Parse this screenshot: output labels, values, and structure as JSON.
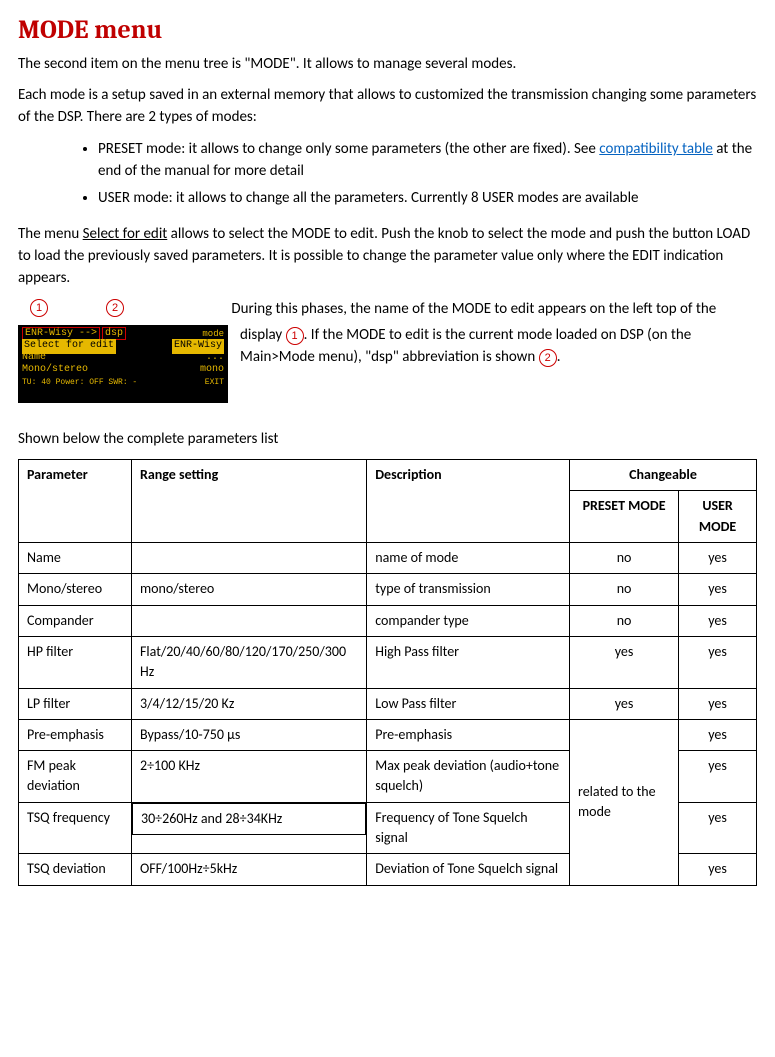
{
  "title": "MODE menu",
  "intro": "The second item on the menu tree is \"MODE\". It allows to manage several modes.",
  "para2a": "Each mode is a setup saved in an external memory that allows to customized the transmission changing some parameters of the DSP. There are 2 types of modes:",
  "bullets": {
    "b1a": "PRESET mode: it allows to change only some parameters (the other are fixed). See ",
    "b1link": "compatibility table",
    "b1b": " at the end of the manual for more detail",
    "b2": "USER mode: it allows to change all the parameters. Currently 8 USER modes are available"
  },
  "para3a": "The menu ",
  "para3u": "Select for edit",
  "para3b": " allows to select the MODE to edit. Push the knob to select the mode and push the button LOAD to load the previously saved parameters. It is possible to change the parameter value only where the EDIT indication appears.",
  "figtop": "During this phases, the name of the MODE to edit appears on the left top of the ",
  "figright_a": "display ",
  "figright_b": ". If the MODE to edit is the current mode loaded on DSP (on the Main>Mode menu), \"dsp\" abbreviation is shown ",
  "figright_c": ".",
  "mark1": "1",
  "mark2": "2",
  "lcd": {
    "r1a": "ENR-Wisy -->",
    "r1b": "dsp",
    "r1r": "mode",
    "r2a": "Select for edit",
    "r2b": "ENR-Wisy",
    "r3a": "Name",
    "r3b": "...",
    "r4a": "Mono/stereo",
    "r4b": "mono",
    "r5a": "TU: 40    Power: OFF    SWR: -",
    "r5b": "EXIT"
  },
  "caption": "Shown below the complete parameters list",
  "th": {
    "param": "Parameter",
    "range": "Range setting",
    "desc": "Description",
    "chg": "Changeable",
    "preset": "PRESET MODE",
    "user": "USER MODE"
  },
  "rows": [
    {
      "param": "Name",
      "range": "",
      "desc": "name of mode",
      "preset": "no",
      "user": "yes"
    },
    {
      "param": "Mono/stereo",
      "range": "mono/stereo",
      "desc": "type of transmission",
      "preset": "no",
      "user": "yes"
    },
    {
      "param": "Compander",
      "range": "",
      "desc": "compander type",
      "preset": "no",
      "user": "yes"
    },
    {
      "param": "HP filter",
      "range": "Flat/20/40/60/80/120/170/250/300 Hz",
      "desc": "High Pass filter",
      "preset": "yes",
      "user": "yes"
    },
    {
      "param": "LP filter",
      "range": "3/4/12/15/20 Kz",
      "desc": "Low Pass filter",
      "preset": "yes",
      "user": "yes"
    },
    {
      "param": "Pre-emphasis",
      "range": "Bypass/10-750 µs",
      "desc": "Pre-emphasis",
      "preset_merge": "related to the mode",
      "user": "yes"
    },
    {
      "param": "FM peak deviation",
      "range": "2÷100 KHz",
      "desc": "Max peak deviation (audio+tone squelch)",
      "user": "yes"
    },
    {
      "param": "TSQ frequency",
      "range": "30÷260Hz and 28÷34KHz",
      "desc": "Frequency of Tone Squelch signal",
      "user": "yes"
    },
    {
      "param": "TSQ deviation",
      "range": "OFF/100Hz÷5kHz",
      "desc": "Deviation of Tone Squelch signal",
      "user": "yes"
    }
  ]
}
